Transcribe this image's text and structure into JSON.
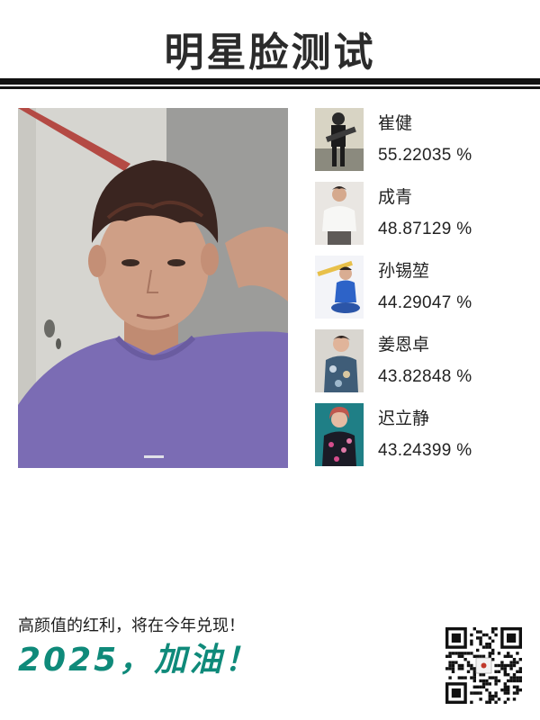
{
  "header": {
    "title": "明星脸测试"
  },
  "matches": [
    {
      "name": "崔健",
      "score": "55.22035 %",
      "thumb_icon": "guitarist-photo"
    },
    {
      "name": "成青",
      "score": "48.87129 %",
      "thumb_icon": "man-white-shirt-photo"
    },
    {
      "name": "孙锡堃",
      "score": "44.29047 %",
      "thumb_icon": "boy-blue-outfit-photo"
    },
    {
      "name": "姜恩卓",
      "score": "43.82848 %",
      "thumb_icon": "boy-printed-jacket-photo"
    },
    {
      "name": "迟立静",
      "score": "43.24399 %",
      "thumb_icon": "woman-teal-backdrop-photo"
    }
  ],
  "footer": {
    "slogan": "高颜值的红利，将在今年兑现！",
    "cheer": "2025，加油！"
  },
  "colors": {
    "accent": "#0f8a7a",
    "title": "#2b2b2b",
    "shirt": "#7b6cb4"
  }
}
